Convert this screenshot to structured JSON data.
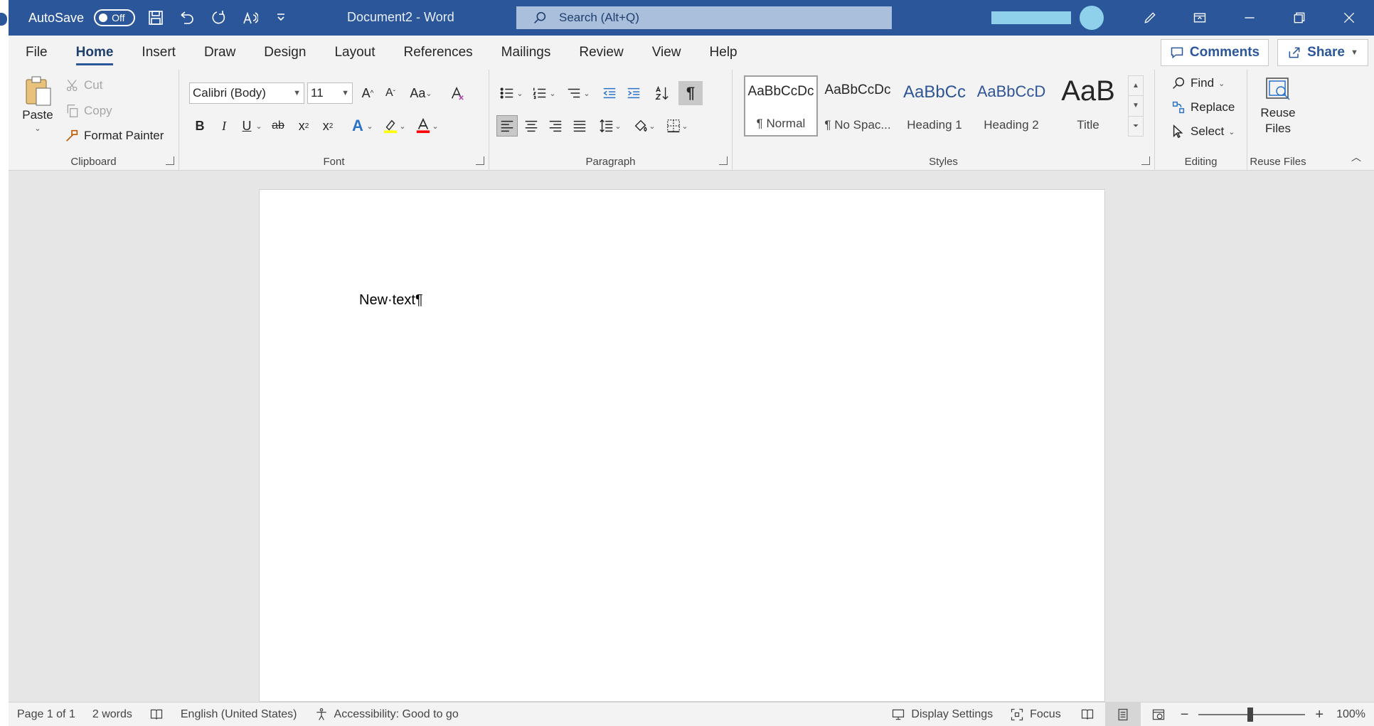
{
  "titlebar": {
    "autosave_label": "AutoSave",
    "autosave_state": "Off",
    "doc_title": "Document2  -  Word",
    "search_placeholder": "Search (Alt+Q)"
  },
  "tabs": [
    "File",
    "Home",
    "Insert",
    "Draw",
    "Design",
    "Layout",
    "References",
    "Mailings",
    "Review",
    "View",
    "Help"
  ],
  "active_tab": "Home",
  "comments_label": "Comments",
  "share_label": "Share",
  "clipboard": {
    "paste": "Paste",
    "cut": "Cut",
    "copy": "Copy",
    "format_painter": "Format Painter",
    "label": "Clipboard"
  },
  "font": {
    "name": "Calibri (Body)",
    "size": "11",
    "change_case": "Aa",
    "label": "Font"
  },
  "paragraph": {
    "label": "Paragraph"
  },
  "styles": {
    "items": [
      {
        "preview": "AaBbCcDc",
        "name": "¶ Normal"
      },
      {
        "preview": "AaBbCcDc",
        "name": "¶ No Spac..."
      },
      {
        "preview": "AaBbCc",
        "name": "Heading 1"
      },
      {
        "preview": "AaBbCcD",
        "name": "Heading 2"
      },
      {
        "preview": "AaB",
        "name": "Title"
      }
    ],
    "label": "Styles"
  },
  "editing": {
    "find": "Find",
    "replace": "Replace",
    "select": "Select",
    "label": "Editing"
  },
  "reuse": {
    "button": "Reuse Files",
    "label": "Reuse Files"
  },
  "document": {
    "text": "New·text¶"
  },
  "statusbar": {
    "page": "Page 1 of 1",
    "words": "2 words",
    "language": "English (United States)",
    "accessibility": "Accessibility: Good to go",
    "display_settings": "Display Settings",
    "focus": "Focus",
    "zoom_minus": "−",
    "zoom_plus": "+",
    "zoom": "100%"
  },
  "colors": {
    "brand": "#2b579a",
    "highlight": "#ffff00",
    "font_color": "#ff0000"
  }
}
